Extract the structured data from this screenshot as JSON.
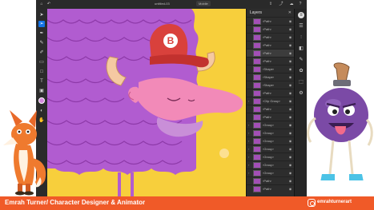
{
  "app": {
    "doc_title": "untitled-03",
    "zoom_label": "Mobile"
  },
  "layers_panel": {
    "title": "Layers",
    "close_label": "✕",
    "rows": [
      "‹Path›",
      "‹Path›",
      "‹Path›",
      "‹Path›",
      "‹Path›",
      "‹Path›",
      "‹Shape›",
      "‹Shape›",
      "‹Shape›",
      "‹Path›",
      "‹Clip Group›",
      "‹Path›",
      "‹Path›",
      "‹Group›",
      "‹Group›",
      "‹Group›",
      "‹Group›",
      "‹Group›",
      "‹Group›",
      "‹Group›",
      "‹Path›",
      "‹Path›"
    ]
  },
  "cap": {
    "letter": "B"
  },
  "banner": {
    "left_text": "Emrah Turner/ Character Designer & Animator",
    "right_text": "emrahturnerart"
  },
  "colors": {
    "canvas_bg": "#f7cf3c",
    "hair": "#b15cd0",
    "cap_red": "#d9413c",
    "banner": "#f05a28"
  },
  "icons": {
    "toolbar": [
      "select-icon",
      "direct-select-icon",
      "pen-icon",
      "pencil-icon",
      "brush-icon",
      "eraser-icon",
      "shape-icon",
      "text-icon",
      "image-icon",
      "eyedropper-icon",
      "hand-icon"
    ],
    "right": [
      "layers-icon",
      "properties-icon",
      "align-icon",
      "pathfinder-icon",
      "brushes-icon",
      "symbols-icon",
      "artboards-icon",
      "assets-icon"
    ]
  }
}
